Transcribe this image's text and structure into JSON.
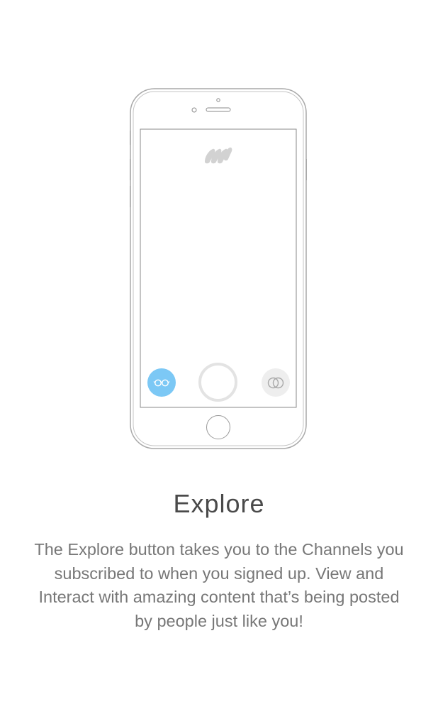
{
  "onboarding": {
    "title": "Explore",
    "description": "The Explore button takes you to the Channels you subscribed to when you signed up. View and Interact with amazing content that’s being posted by people just like you!"
  },
  "phone": {
    "logo_icon": "brand-logo-icon",
    "buttons": {
      "explore": {
        "icon": "glasses-icon",
        "color": "#7cc8f5"
      },
      "capture": {
        "icon": "capture-ring-icon",
        "color": "#e3e3e3"
      },
      "rings": {
        "icon": "interlocking-rings-icon",
        "color": "#eeeeee"
      }
    }
  }
}
